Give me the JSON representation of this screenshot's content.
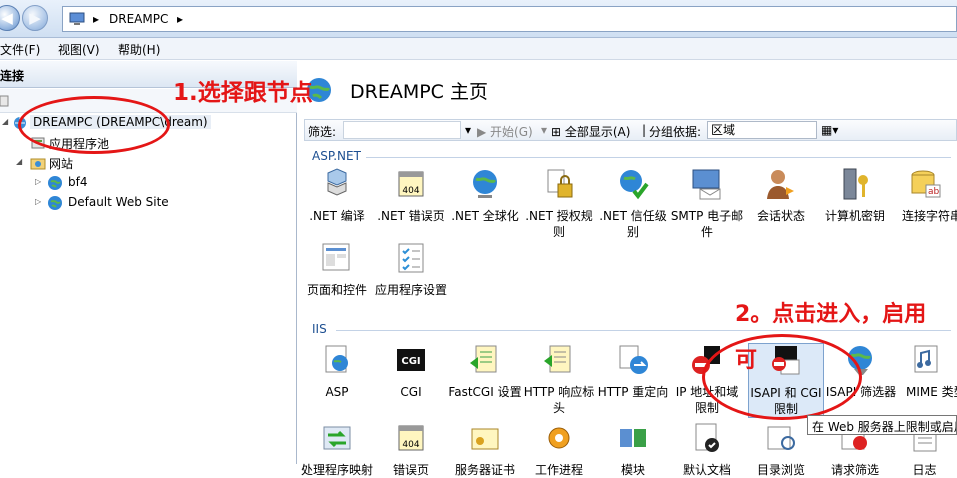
{
  "address": {
    "segments": [
      "DREAMPC"
    ],
    "separator": "▸"
  },
  "menu": [
    "文件(F)",
    "视图(V)",
    "帮助(H)"
  ],
  "connections": {
    "header": "连接",
    "tree": [
      {
        "label": "DREAMPC (DREAMPC\\dream)",
        "level": 0
      },
      {
        "label": "应用程序池",
        "level": 1
      },
      {
        "label": "网站",
        "level": 1
      },
      {
        "label": "bf4",
        "level": 2
      },
      {
        "label": "Default Web Site",
        "level": 2
      }
    ]
  },
  "page": {
    "title": "DREAMPC 主页"
  },
  "filterbar": {
    "filter_label": "筛选:",
    "start_label": "开始(G)",
    "show_all_label": "全部显示(A)",
    "group_label": "分组依据:",
    "group_value": "区域"
  },
  "sections": {
    "aspnet": "ASP.NET",
    "iis": "IIS"
  },
  "aspnet_features": [
    ".NET 编译",
    ".NET 错误页",
    ".NET 全球化",
    ".NET 授权规则",
    ".NET 信任级别",
    "SMTP 电子邮件",
    "会话状态",
    "计算机密钥",
    "连接字符串",
    "页面和控件",
    "应用程序设置"
  ],
  "iis_features": [
    "ASP",
    "CGI",
    "FastCGI 设置",
    "HTTP 响应标头",
    "HTTP 重定向",
    "IP 地址和域限制",
    "ISAPI 和 CGI 限制",
    "ISAPI 筛选器",
    "MIME 类型"
  ],
  "iis_row3": [
    "处理程序映射",
    "错误页",
    "服务器证书",
    "工作进程",
    "模块",
    "默认文档",
    "目录浏览",
    "请求筛选",
    "日志"
  ],
  "icon_texts": {
    "err404": "404",
    "cgi": "CGI",
    "ab": "ab"
  },
  "annotations": {
    "step1": "1.选择跟节点",
    "step2_line1": "2。点击进入，启用",
    "step2_line2": "可"
  },
  "tooltip": "在 Web 服务器上限制或启用",
  "colors": {
    "annotation": "#e41616",
    "accent": "#1d4f91"
  }
}
